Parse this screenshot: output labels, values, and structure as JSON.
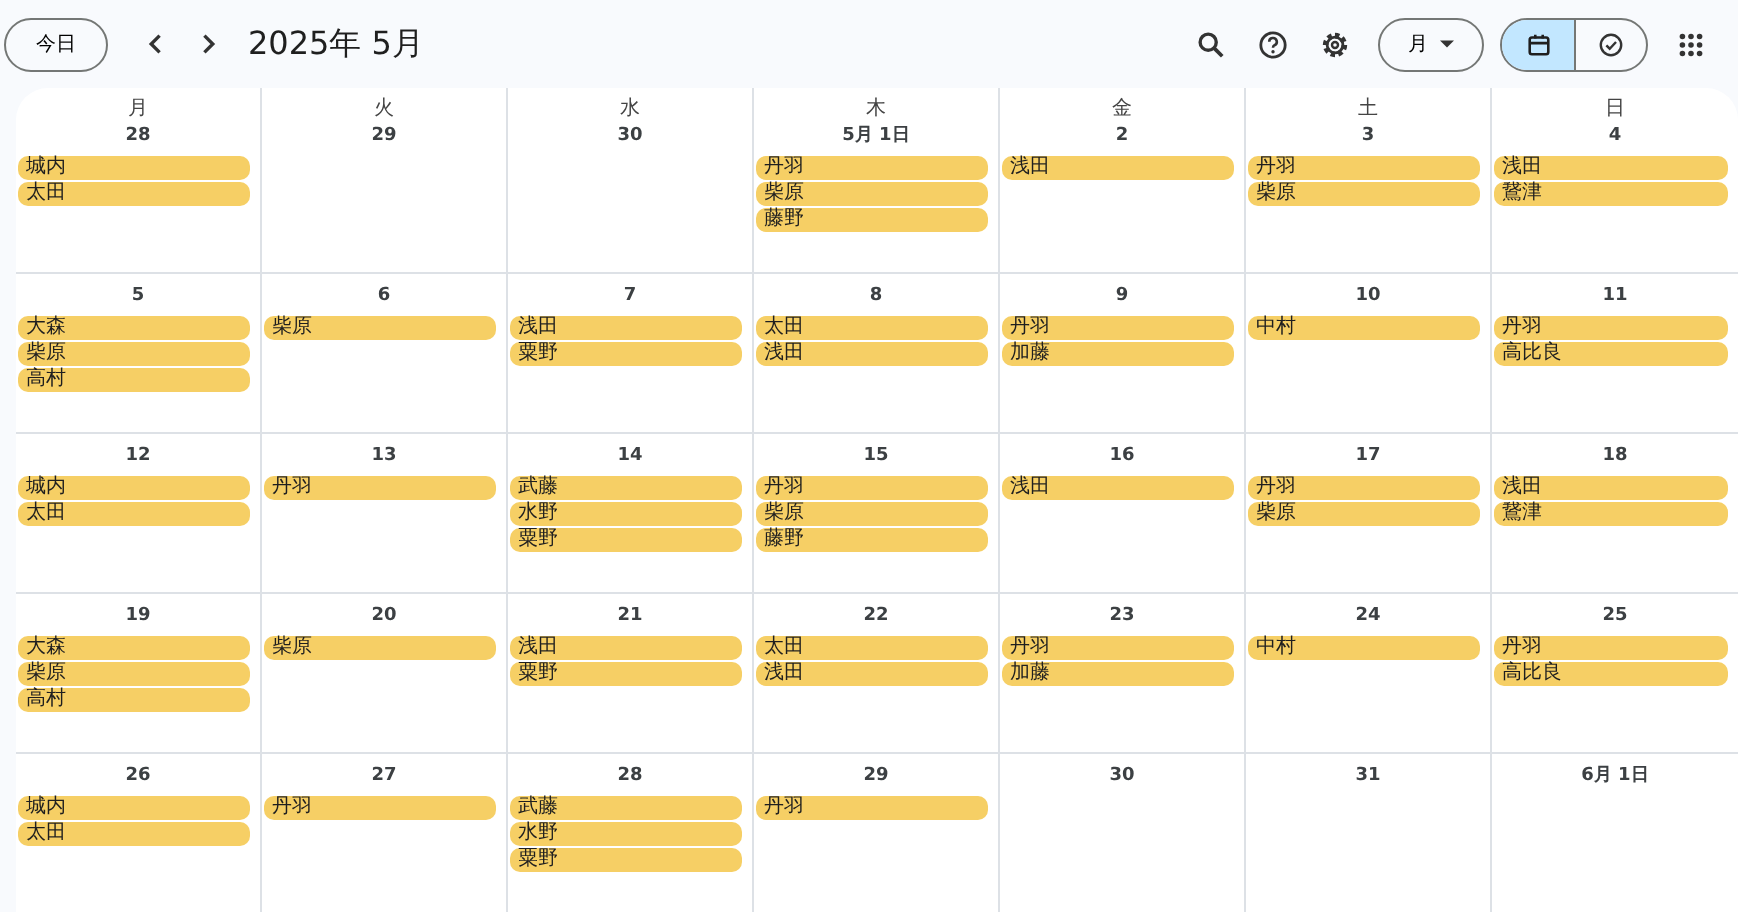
{
  "toolbar": {
    "today_button": "今日",
    "title": "2025年 5月",
    "view_dropdown": "月",
    "view_toggle": [
      {
        "kind": "calendar",
        "selected": true
      },
      {
        "kind": "tasks",
        "selected": false
      }
    ]
  },
  "weekdays": [
    "月",
    "火",
    "水",
    "木",
    "金",
    "土",
    "日"
  ],
  "weeks": [
    {
      "days": [
        {
          "date": "28",
          "events": [
            "城内",
            "太田"
          ]
        },
        {
          "date": "29"
        },
        {
          "date": "30"
        },
        {
          "date": "5月 1日",
          "events": [
            "丹羽",
            "柴原",
            "藤野"
          ]
        },
        {
          "date": "2",
          "events": [
            "浅田"
          ]
        },
        {
          "date": "3",
          "events": [
            "丹羽",
            "柴原"
          ]
        },
        {
          "date": "4",
          "events": [
            "浅田",
            "鵞津"
          ]
        }
      ]
    },
    {
      "days": [
        {
          "date": "5",
          "events": [
            "大森",
            "柴原",
            "高村"
          ]
        },
        {
          "date": "6",
          "events": [
            "柴原"
          ]
        },
        {
          "date": "7",
          "events": [
            "浅田",
            "粟野"
          ]
        },
        {
          "date": "8",
          "events": [
            "太田",
            "浅田"
          ]
        },
        {
          "date": "9",
          "events": [
            "丹羽",
            "加藤"
          ]
        },
        {
          "date": "10",
          "events": [
            "中村"
          ]
        },
        {
          "date": "11",
          "events": [
            "丹羽",
            "高比良"
          ]
        }
      ]
    },
    {
      "days": [
        {
          "date": "12",
          "events": [
            "城内",
            "太田"
          ]
        },
        {
          "date": "13",
          "events": [
            "丹羽"
          ]
        },
        {
          "date": "14",
          "events": [
            "武藤",
            "水野",
            "粟野"
          ]
        },
        {
          "date": "15",
          "events": [
            "丹羽",
            "柴原",
            "藤野"
          ]
        },
        {
          "date": "16",
          "events": [
            "浅田"
          ]
        },
        {
          "date": "17",
          "events": [
            "丹羽",
            "柴原"
          ]
        },
        {
          "date": "18",
          "events": [
            "浅田",
            "鵞津"
          ]
        }
      ]
    },
    {
      "days": [
        {
          "date": "19",
          "events": [
            "大森",
            "柴原",
            "高村"
          ]
        },
        {
          "date": "20",
          "events": [
            "柴原"
          ]
        },
        {
          "date": "21",
          "events": [
            "浅田",
            "粟野"
          ]
        },
        {
          "date": "22",
          "events": [
            "太田",
            "浅田"
          ]
        },
        {
          "date": "23",
          "events": [
            "丹羽",
            "加藤"
          ]
        },
        {
          "date": "24",
          "events": [
            "中村"
          ]
        },
        {
          "date": "25",
          "events": [
            "丹羽",
            "高比良"
          ]
        }
      ]
    },
    {
      "days": [
        {
          "date": "26",
          "events": [
            "城内",
            "太田"
          ]
        },
        {
          "date": "27",
          "events": [
            "丹羽"
          ]
        },
        {
          "date": "28",
          "events": [
            "武藤",
            "水野",
            "粟野"
          ]
        },
        {
          "date": "29",
          "events": [
            "丹羽"
          ]
        },
        {
          "date": "30"
        },
        {
          "date": "31"
        },
        {
          "date": "6月 1日"
        }
      ]
    }
  ]
}
